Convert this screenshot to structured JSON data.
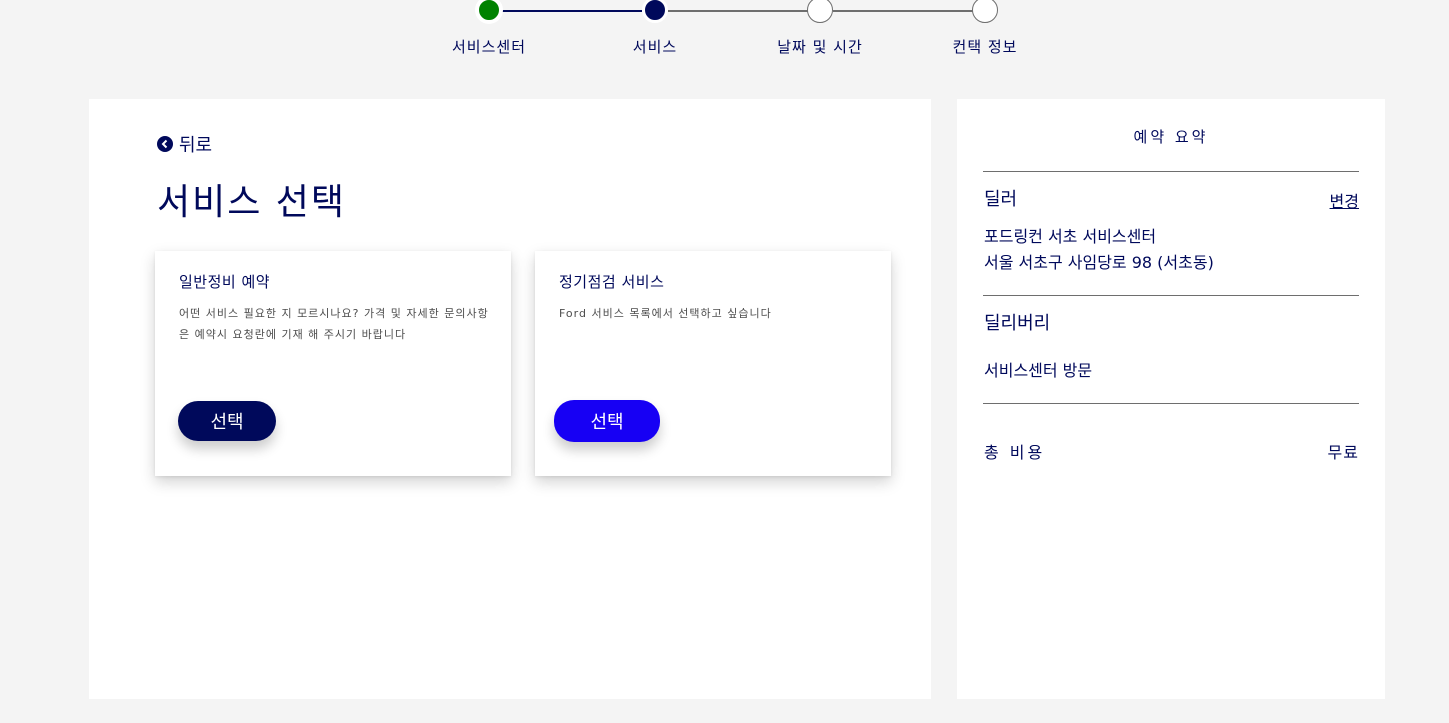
{
  "stepper": {
    "steps": [
      {
        "label": "서비스센터",
        "state": "complete"
      },
      {
        "label": "서비스",
        "state": "active"
      },
      {
        "label": "날짜 및 시간",
        "state": "pending"
      },
      {
        "label": "컨택 정보",
        "state": "pending"
      }
    ],
    "colors": {
      "complete": "#008200",
      "active": "#00095b",
      "pending": "#ffffff"
    }
  },
  "main": {
    "back_label": "뒤로",
    "title": "서비스 선택",
    "cards": [
      {
        "title": "일반정비 예약",
        "description": "어떤 서비스 필요한 지 모르시나요? 가격 및 자세한 문의사항은 예약시 요청란에 기재 해 주시기 바랍니다",
        "button_label": "선택",
        "button_color": "#00095b"
      },
      {
        "title": "정기점검 서비스",
        "description": "Ford 서비스 목록에서 선택하고 싶습니다",
        "button_label": "선택",
        "button_color": "#1700f4"
      }
    ]
  },
  "summary": {
    "title": "예약 요약",
    "dealer": {
      "label": "딜러",
      "change_label": "변경",
      "name": "포드링컨 서초 서비스센터",
      "address": "서울 서초구 사임당로 98 (서초동)"
    },
    "delivery": {
      "label": "딜리버리",
      "value": "서비스센터 방문"
    },
    "total": {
      "label": "총 비용",
      "value": "무료"
    }
  }
}
